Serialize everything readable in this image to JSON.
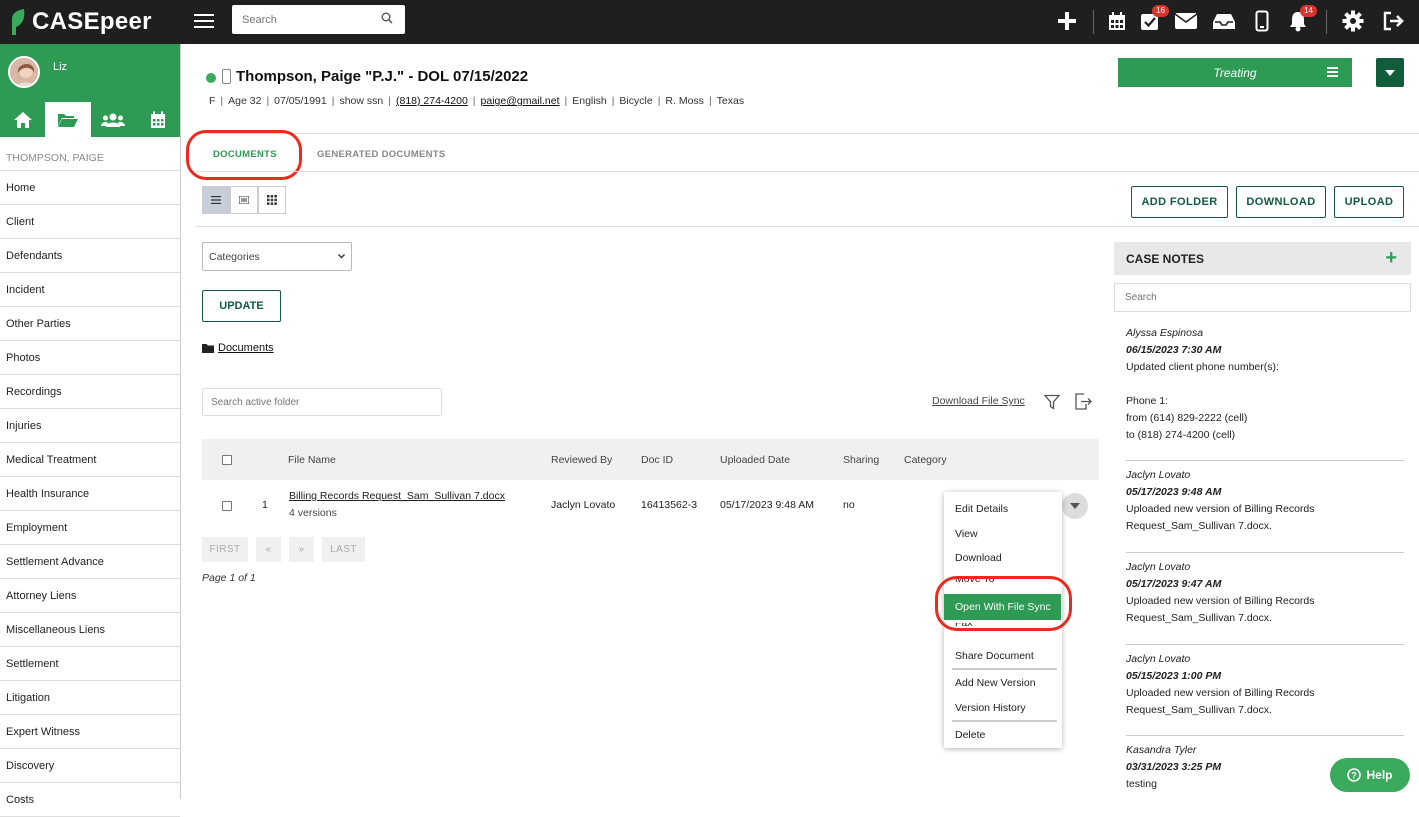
{
  "app": {
    "logo_text": "CASEpeer",
    "search_placeholder": "Search"
  },
  "topbar": {
    "tasks_badge": "16",
    "notifications_badge": "14"
  },
  "user": {
    "name": "Liz"
  },
  "sidebar": {
    "client_name": "THOMPSON, PAIGE",
    "items": [
      "Home",
      "Client",
      "Defendants",
      "Incident",
      "Other Parties",
      "Photos",
      "Recordings",
      "Injuries",
      "Medical Treatment",
      "Health Insurance",
      "Employment",
      "Settlement Advance",
      "Attorney Liens",
      "Miscellaneous Liens",
      "Settlement",
      "Litigation",
      "Expert Witness",
      "Discovery",
      "Costs"
    ]
  },
  "case": {
    "title": "Thompson, Paige \"P.J.\" - DOL 07/15/2022",
    "meta": [
      "F",
      "Age 32",
      "07/05/1991",
      "show ssn",
      "(818) 274-4200",
      "paige@gmail.net",
      "English",
      "Bicycle",
      "R. Moss",
      "Texas"
    ],
    "status": "Treating",
    "colors": {
      "brand_green": "#2e9b55",
      "dark_green": "#115c3a",
      "annotation_red": "#ec2a1f"
    }
  },
  "tabs": {
    "documents": "DOCUMENTS",
    "generated": "GENERATED DOCUMENTS"
  },
  "actions": {
    "add_folder": "ADD FOLDER",
    "download": "DOWNLOAD",
    "upload": "UPLOAD"
  },
  "filters": {
    "categories": "Categories",
    "update": "UPDATE",
    "breadcrumb": "Documents",
    "folder_search": "Search active folder",
    "download_file_sync": "Download File Sync"
  },
  "table": {
    "headers": {
      "file_name": "File Name",
      "reviewed_by": "Reviewed By",
      "doc_id": "Doc ID",
      "uploaded": "Uploaded Date",
      "sharing": "Sharing",
      "category": "Category"
    },
    "rows": [
      {
        "index": "1",
        "file_name": "Billing Records Request_Sam_Sullivan 7.docx",
        "versions": "4 versions",
        "reviewed_by": "Jaclyn Lovato",
        "doc_id": "16413562-3",
        "uploaded": "05/17/2023 9:48 AM",
        "sharing": "no"
      }
    ]
  },
  "pagination": {
    "first": "FIRST",
    "prev": "«",
    "next": "»",
    "last": "LAST",
    "page_of": "Page 1 of 1"
  },
  "context_menu": [
    "Edit Details",
    "View",
    "Download",
    "Move To",
    "Open With File Sync",
    "Fax",
    "Share Document",
    "Add New Version",
    "Version History",
    "Delete"
  ],
  "notes": {
    "title": "CASE NOTES",
    "search_placeholder": "Search",
    "items": [
      {
        "author": "Alyssa Espinosa",
        "date": "06/15/2023 7:30 AM",
        "lines": [
          "Updated client phone number(s):",
          "",
          "Phone 1:",
          "from (614) 829-2222 (cell)",
          "to (818) 274-4200 (cell)"
        ]
      },
      {
        "author": "Jaclyn Lovato",
        "date": "05/17/2023 9:48 AM",
        "lines": [
          "Uploaded new version of Billing Records",
          "Request_Sam_Sullivan 7.docx."
        ]
      },
      {
        "author": "Jaclyn Lovato",
        "date": "05/17/2023 9:47 AM",
        "lines": [
          "Uploaded new version of Billing Records",
          "Request_Sam_Sullivan 7.docx."
        ]
      },
      {
        "author": "Jaclyn Lovato",
        "date": "05/15/2023 1:00 PM",
        "lines": [
          "Uploaded new version of Billing Records",
          "Request_Sam_Sullivan 7.docx."
        ]
      },
      {
        "author": "Kasandra Tyler",
        "date": "03/31/2023 3:25 PM",
        "lines": [
          "testing"
        ]
      }
    ]
  },
  "help": {
    "label": "Help"
  }
}
